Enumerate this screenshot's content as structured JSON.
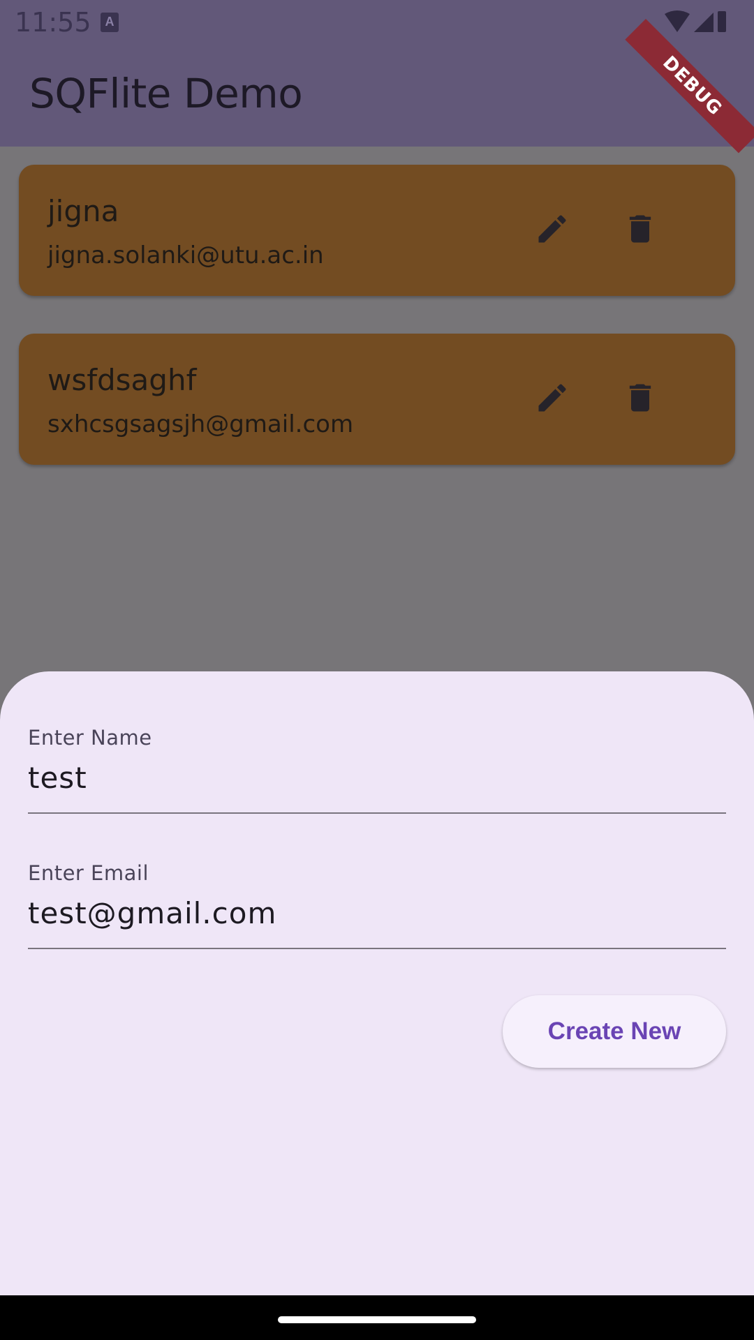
{
  "status_bar": {
    "time": "11:55",
    "icons": [
      "wifi-icon",
      "signal-icon",
      "battery-icon"
    ]
  },
  "app_bar": {
    "title": "SQFlite Demo"
  },
  "debug_banner": "DEBUG",
  "records": [
    {
      "name": "jigna",
      "email": "jigna.solanki@utu.ac.in"
    },
    {
      "name": "wsfdsaghf",
      "email": "sxhcsgsagsjh@gmail.com"
    }
  ],
  "form": {
    "name_label": "Enter Name",
    "name_value": "test",
    "email_label": "Enter Email",
    "email_value": "test@gmail.com",
    "submit_label": "Create New"
  },
  "colors": {
    "app_bar": "#625879",
    "card": "#734c22",
    "sheet": "#efe6f7",
    "accent": "#6a44b4",
    "scrim": "#777578"
  }
}
